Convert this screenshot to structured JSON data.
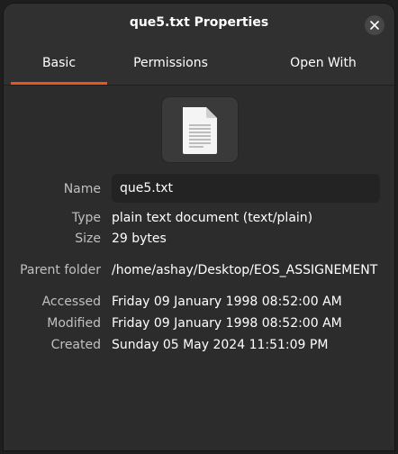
{
  "window": {
    "title": "que5.txt Properties"
  },
  "tabs": [
    {
      "label": "Basic",
      "active": true
    },
    {
      "label": "Permissions",
      "active": false
    },
    {
      "label": "Open With",
      "active": false
    }
  ],
  "file_icon": "text-document-icon",
  "properties": {
    "name_label": "Name",
    "name_value": "que5.txt",
    "type_label": "Type",
    "type_value": "plain text document (text/plain)",
    "size_label": "Size",
    "size_value": "29 bytes",
    "parent_label": "Parent folder",
    "parent_value": "/home/ashay/Desktop/EOS_ASSIGNEMENT",
    "accessed_label": "Accessed",
    "accessed_value": "Friday 09 January 1998 08:52:00 AM",
    "modified_label": "Modified",
    "modified_value": "Friday 09 January 1998 08:52:00 AM",
    "created_label": "Created",
    "created_value": "Sunday 05 May 2024 11:51:09 PM"
  },
  "colors": {
    "accent": "#e95420",
    "background": "#2c2c2c"
  }
}
